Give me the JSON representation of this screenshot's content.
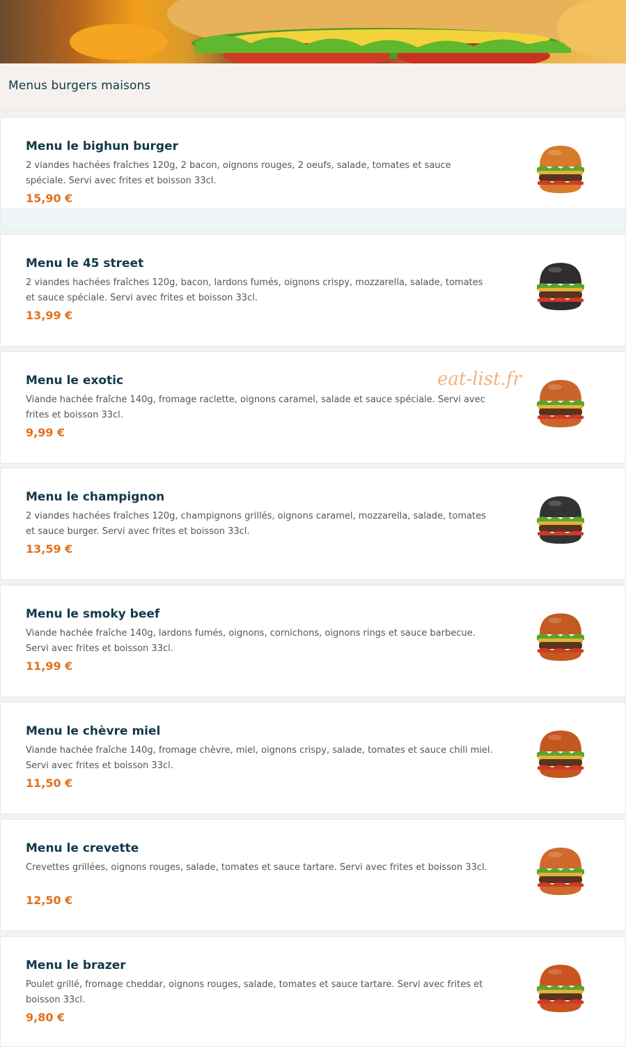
{
  "section": {
    "title": "Menus burgers maisons"
  },
  "watermark": "eat-list.fr",
  "items": [
    {
      "name": "Menu le bighun burger",
      "desc": "2 viandes hachées fraîches 120g, 2 bacon, oignons rouges, 2 oeufs, salade, tomates et sauce spéciale. Servi avec frites et boisson 33cl.",
      "price": "15,90 €",
      "bun": "#d77a2a"
    },
    {
      "name": "Menu le 45 street",
      "desc": "2 viandes hachées fraîches 120g, bacon, lardons fumés, oignons crispy, mozzarella, salade, tomates et sauce spéciale. Servi avec frites et boisson 33cl.",
      "price": "13,99 €",
      "bun": "#2d2d2d"
    },
    {
      "name": "Menu le exotic",
      "desc": "Viande hachée fraîche 140g, fromage raclette, oignons caramel, salade et sauce spéciale. Servi avec frites et boisson 33cl.",
      "price": "9,99 €",
      "bun": "#c9652a"
    },
    {
      "name": "Menu le champignon",
      "desc": "2 viandes hachées fraîches 120g, champignons grillés, oignons caramel, mozzarella, salade, tomates et sauce burger. Servi avec frites et boisson 33cl.",
      "price": "13,59 €",
      "bun": "#333333"
    },
    {
      "name": "Menu le smoky beef",
      "desc": "Viande hachée fraîche 140g, lardons fumés, oignons, cornichons, oignons rings et sauce barbecue. Servi avec frites et boisson 33cl.",
      "price": "11,99 €",
      "bun": "#c25a22"
    },
    {
      "name": "Menu le chèvre miel",
      "desc": "Viande hachée fraîche 140g, fromage chèvre, miel, oignons crispy, salade, tomates et sauce chili miel. Servi avec frites et boisson 33cl.",
      "price": "11,50 €",
      "bun": "#c4561f"
    },
    {
      "name": "Menu le crevette",
      "desc": "Crevettes grillées, oignons rouges, salade, tomates et sauce tartare. Servi avec frites et boisson 33cl.",
      "price": "12,50 €",
      "bun": "#cf6a2c"
    },
    {
      "name": "Menu le brazer",
      "desc": "Poulet grillé, fromage cheddar, oignons rouges, salade, tomates et sauce tartare. Servi avec frites et boisson 33cl.",
      "price": "9,80 €",
      "bun": "#c9541f"
    }
  ]
}
